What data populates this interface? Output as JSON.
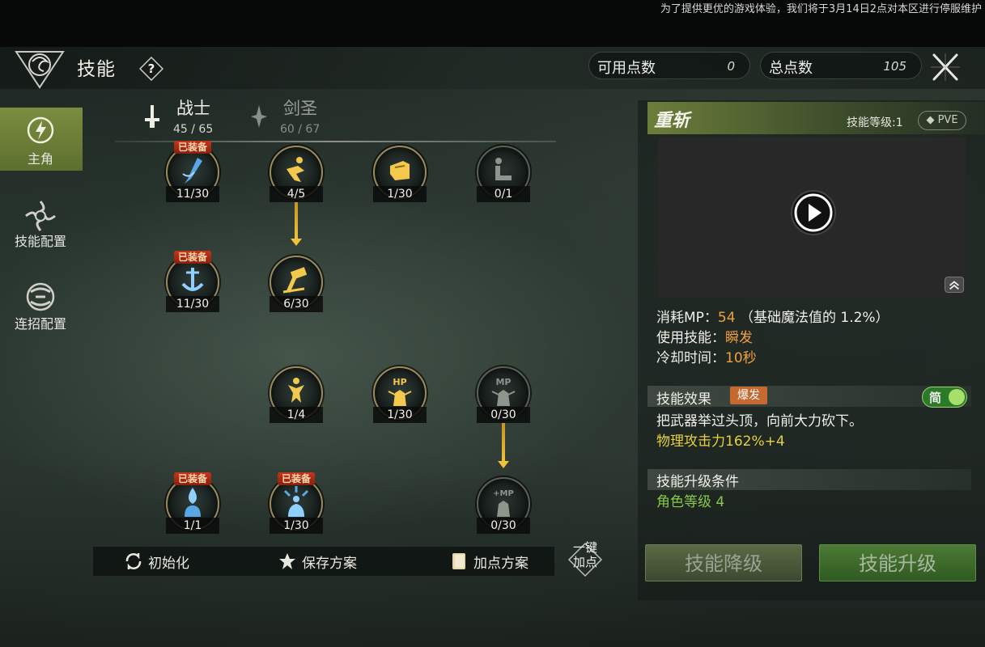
{
  "notice": "为了提供更优的游戏体验，我们将于3月14日2点对本区进行停服维护",
  "header": {
    "title": "技能",
    "available_points_label": "可用点数",
    "available_points_value": "0",
    "total_points_label": "总点数",
    "total_points_value": "105"
  },
  "nav": {
    "items": [
      {
        "label": "主角"
      },
      {
        "label": "技能配置"
      },
      {
        "label": "连招配置"
      }
    ]
  },
  "class_tabs": [
    {
      "name": "战士",
      "points": "45 / 65"
    },
    {
      "name": "剑圣",
      "points": "60 / 67"
    }
  ],
  "skills": [
    {
      "level": "11/30",
      "equipped": "已装备",
      "icon": "sword-slash-icon"
    },
    {
      "level": "4/5",
      "equipped": "",
      "icon": "dash-runner-icon"
    },
    {
      "level": "1/30",
      "equipped": "",
      "icon": "fist-strike-icon"
    },
    {
      "level": "0/1",
      "equipped": "",
      "icon": "kick-icon"
    },
    {
      "level": "11/30",
      "equipped": "已装备",
      "icon": "anchor-ice-icon"
    },
    {
      "level": "6/30",
      "equipped": "",
      "icon": "hammer-smash-icon"
    },
    {
      "level": "1/4",
      "equipped": "",
      "icon": "jump-figure-icon"
    },
    {
      "level": "1/30",
      "equipped": "",
      "icon": "hp-boost-icon",
      "badge": "HP"
    },
    {
      "level": "0/30",
      "equipped": "",
      "icon": "mp-boost-icon",
      "badge": "MP"
    },
    {
      "level": "1/1",
      "equipped": "已装备",
      "icon": "water-drop-figure-icon"
    },
    {
      "level": "1/30",
      "equipped": "已装备",
      "icon": "ice-burst-figure-icon"
    },
    {
      "level": "0/30",
      "equipped": "",
      "icon": "mp-plus-icon",
      "badge": "+MP"
    }
  ],
  "bottom": {
    "reset_label": "初始化",
    "save_label": "保存方案",
    "load_label": "加点方案",
    "onekey_line1": "一键",
    "onekey_line2": "加点"
  },
  "detail": {
    "skill_name": "重斩",
    "skill_level": "技能等级:1",
    "mode": "PVE",
    "mp_label": "消耗MP：",
    "mp_value": "54",
    "mp_note": "（基础魔法值的 1.2%）",
    "use_label": "使用技能：",
    "use_value": "瞬发",
    "cd_label": "冷却时间：",
    "cd_value": "10秒",
    "effect_title": "技能效果",
    "effect_tag": "爆发",
    "toggle_label": "简",
    "effect_desc": "把武器举过头顶，向前大力砍下。",
    "effect_stat": "物理攻击力162%+4",
    "upgrade_title": "技能升级条件",
    "upgrade_req": "角色等级 4",
    "downgrade_btn": "技能降级",
    "upgrade_btn": "技能升级"
  },
  "colors": {
    "accent_green": "#7b8d3f",
    "highlight_orange": "#f39f3c",
    "stat_yellow": "#e6d13c",
    "req_green": "#86c94a",
    "equip_red": "#c4361a"
  }
}
